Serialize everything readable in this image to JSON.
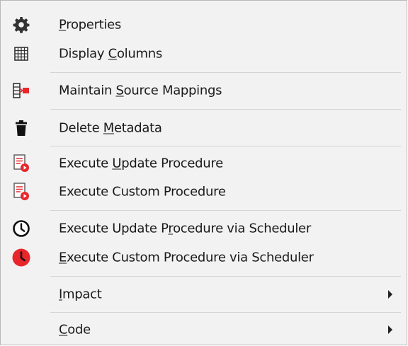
{
  "menu": {
    "items": [
      {
        "pre": "",
        "key": "P",
        "post": "roperties",
        "icon": "gear-icon"
      },
      {
        "pre": "Display ",
        "key": "C",
        "post": "olumns",
        "icon": "grid-icon"
      },
      {
        "pre": "Maintain ",
        "key": "S",
        "post": "ource Mappings",
        "icon": "source-mapping-icon"
      },
      {
        "pre": "Delete ",
        "key": "M",
        "post": "etadata",
        "icon": "trash-icon"
      },
      {
        "pre": "Execute ",
        "key": "U",
        "post": "pdate Procedure",
        "icon": "execute-procedure-icon"
      },
      {
        "pre": "Execute Custom Procedure",
        "key": "",
        "post": "",
        "icon": "execute-procedure-icon"
      },
      {
        "pre": "Execute Update P",
        "key": "r",
        "post": "ocedure via Scheduler",
        "icon": "clock-icon"
      },
      {
        "pre": "",
        "key": "E",
        "post": "xecute Custom Procedure via Scheduler",
        "icon": "clock-red-icon"
      },
      {
        "pre": "",
        "key": "I",
        "post": "mpact",
        "icon": "",
        "submenu": true
      },
      {
        "pre": "",
        "key": "C",
        "post": "ode",
        "icon": "",
        "submenu": true
      }
    ]
  },
  "colors": {
    "background": "#f2f2f2",
    "separator": "#d4d4d4",
    "accent_red": "#e8262b"
  }
}
